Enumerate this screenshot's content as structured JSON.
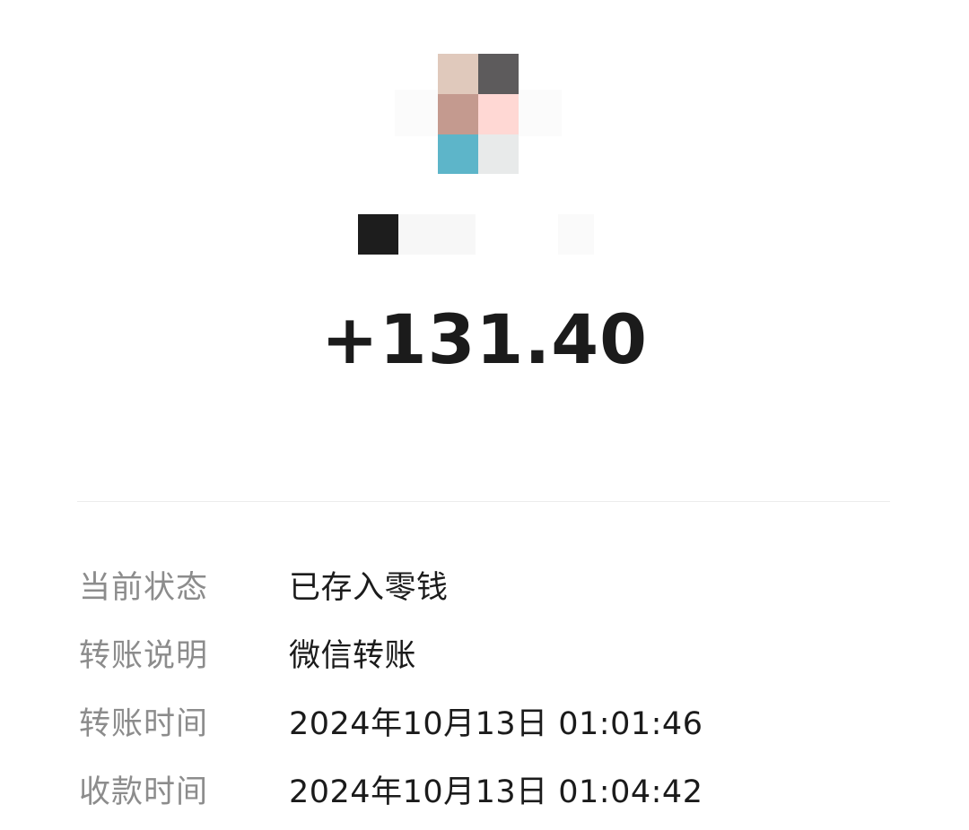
{
  "header": {
    "avatar_colors": [
      "#e0c9bc",
      "#5d5b5c",
      "#c49a8f",
      "#ffd8d4",
      "#5db5c9",
      "#e8eaea"
    ],
    "payer_name_colors": [
      "#1d1d1d",
      "#f7f7f7",
      "#ffffff",
      "#fafafa"
    ]
  },
  "transaction": {
    "amount": "+131.40"
  },
  "details": [
    {
      "label": "当前状态",
      "value": "已存入零钱"
    },
    {
      "label": "转账说明",
      "value": "微信转账"
    },
    {
      "label": "转账时间",
      "value": "2024年10月13日 01:01:46"
    },
    {
      "label": "收款时间",
      "value": "2024年10月13日 01:04:42"
    }
  ]
}
